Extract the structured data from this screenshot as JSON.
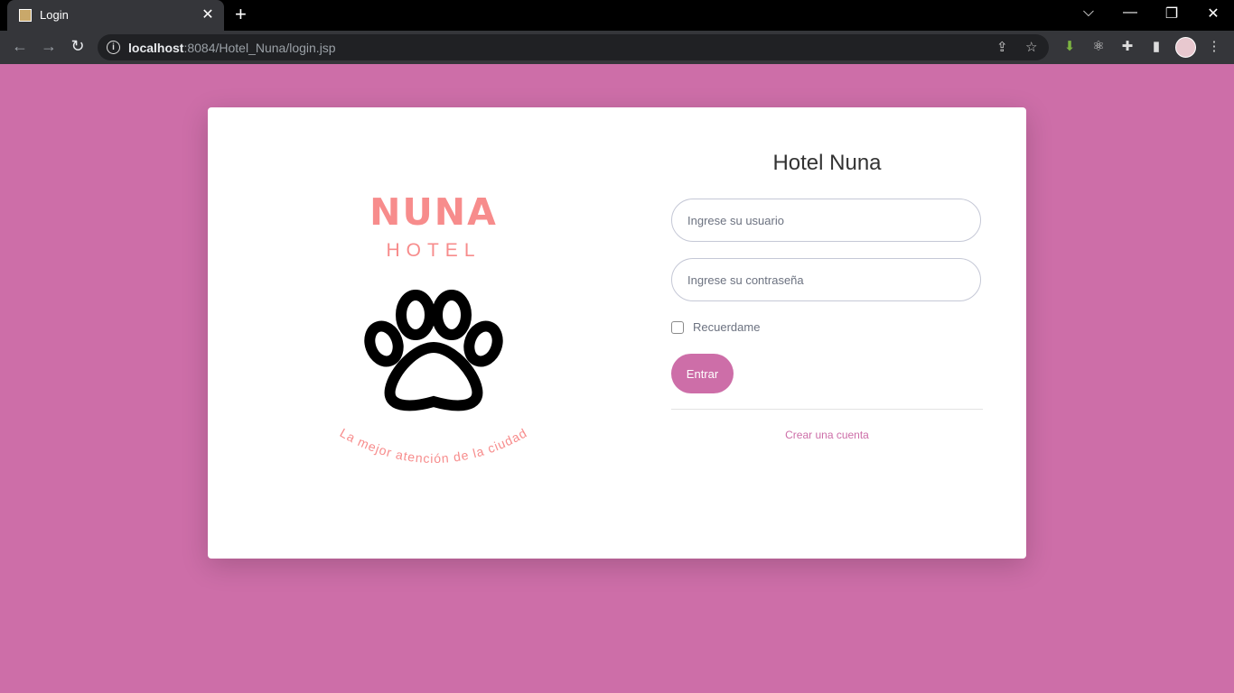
{
  "browser": {
    "tab_title": "Login",
    "tab_close": "✕",
    "new_tab": "+",
    "url_host": "localhost",
    "url_rest": ":8084/Hotel_Nuna/login.jsp",
    "window_controls": {
      "dropdown": "⌵",
      "minimize": "—",
      "restore": "❐",
      "close": "✕"
    }
  },
  "logo": {
    "name": "NUNA",
    "subtitle": "HOTEL",
    "slogan": "La mejor atención de la ciudad",
    "icon": "paw-icon",
    "color": "#f78c8c"
  },
  "form": {
    "title": "Hotel Nuna",
    "username_placeholder": "Ingrese su usuario",
    "username_value": "",
    "password_placeholder": "Ingrese su contraseña",
    "password_value": "",
    "remember_label": "Recuerdame",
    "remember_checked": false,
    "submit_label": "Entrar",
    "create_account_label": "Crear una cuenta"
  },
  "colors": {
    "background": "#cd6ea8",
    "accent": "#cd6ea8",
    "logo": "#f78c8c"
  }
}
